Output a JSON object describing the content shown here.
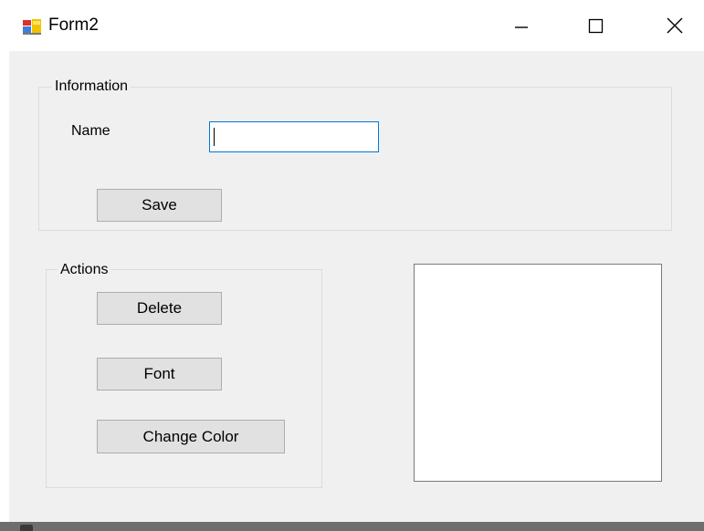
{
  "window": {
    "title": "Form2",
    "controls": {
      "minimize": "minimize-icon",
      "maximize": "maximize-icon",
      "close": "close-icon"
    }
  },
  "information_group": {
    "legend": "Information",
    "name_label": "Name",
    "name_value": "",
    "save_label": "Save"
  },
  "actions_group": {
    "legend": "Actions",
    "delete_label": "Delete",
    "font_label": "Font",
    "change_color_label": "Change Color"
  },
  "colors": {
    "client_background": "#f0f0f0",
    "button_face": "#e1e1e1",
    "focus_border": "#0078d7"
  }
}
